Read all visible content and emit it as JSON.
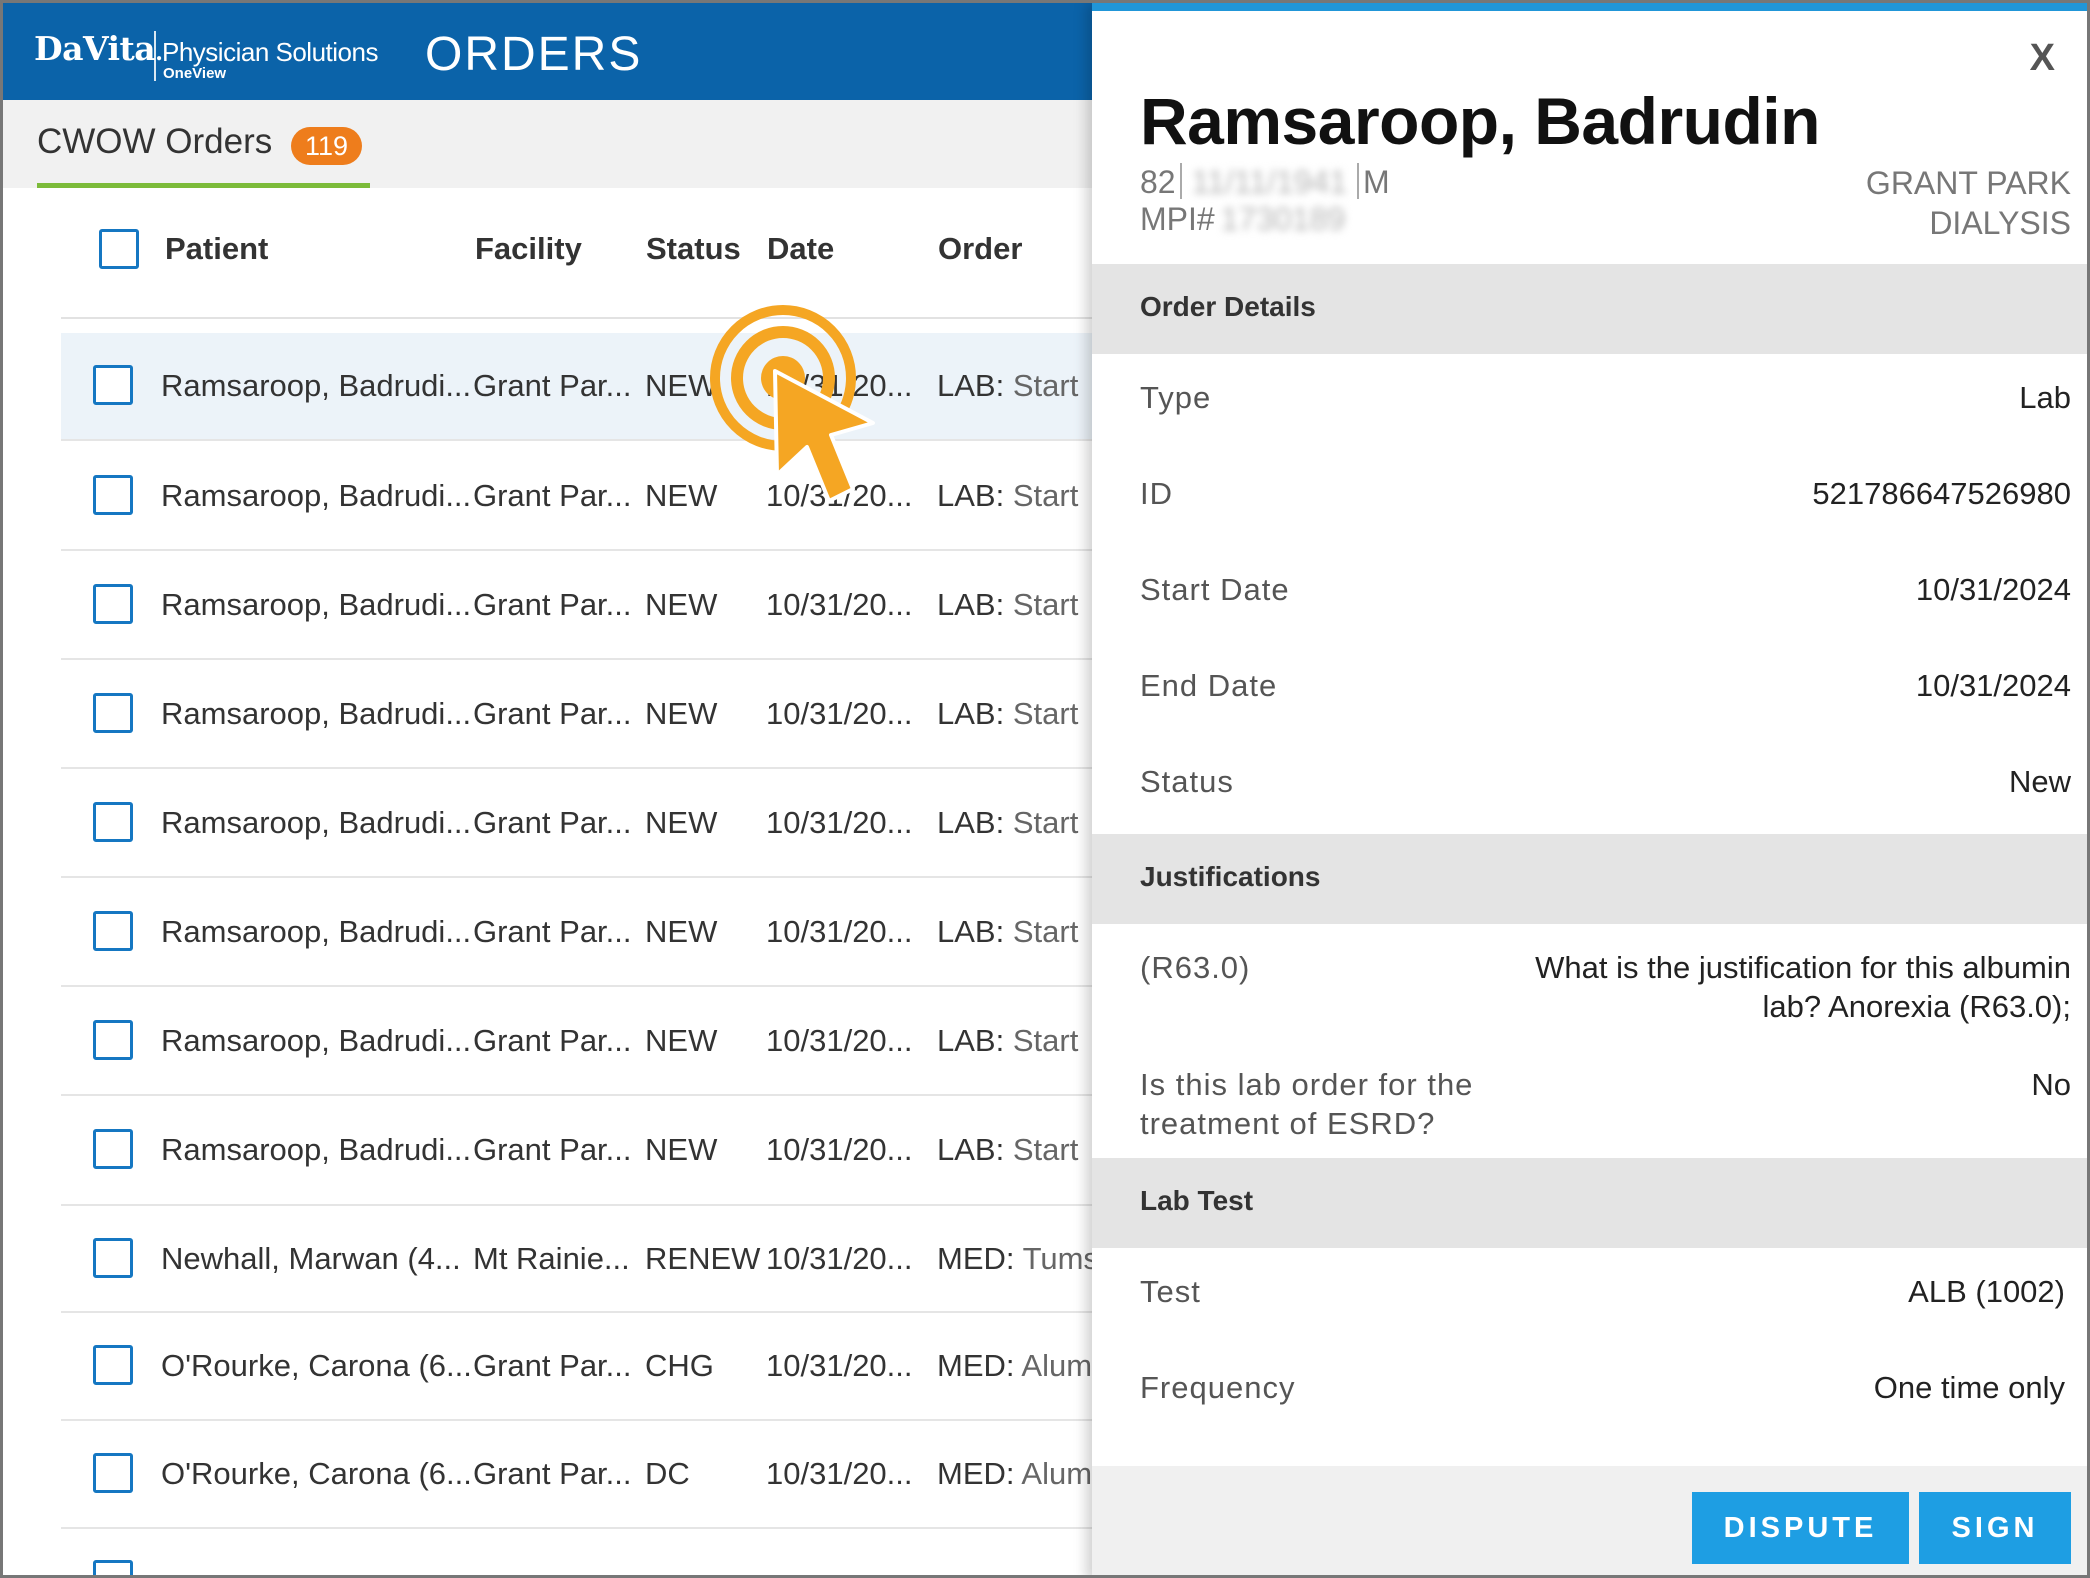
{
  "header": {
    "brand": "DaVita",
    "product": "Physician Solutions",
    "sub_product": "OneView",
    "title": "ORDERS"
  },
  "tab": {
    "label": "CWOW Orders",
    "count": "119"
  },
  "table": {
    "columns": [
      "Patient",
      "Facility",
      "Status",
      "Date",
      "Order"
    ],
    "rows": [
      {
        "patient": "Ramsaroop, Badrudi...",
        "facility": "Grant Par...",
        "status": "NEW",
        "date": "10/31/20...",
        "order_type": "LAB:",
        "order_desc": "Start"
      },
      {
        "patient": "Ramsaroop, Badrudi...",
        "facility": "Grant Par...",
        "status": "NEW",
        "date": "10/31/20...",
        "order_type": "LAB:",
        "order_desc": "Start"
      },
      {
        "patient": "Ramsaroop, Badrudi...",
        "facility": "Grant Par...",
        "status": "NEW",
        "date": "10/31/20...",
        "order_type": "LAB:",
        "order_desc": "Start"
      },
      {
        "patient": "Ramsaroop, Badrudi...",
        "facility": "Grant Par...",
        "status": "NEW",
        "date": "10/31/20...",
        "order_type": "LAB:",
        "order_desc": "Start"
      },
      {
        "patient": "Ramsaroop, Badrudi...",
        "facility": "Grant Par...",
        "status": "NEW",
        "date": "10/31/20...",
        "order_type": "LAB:",
        "order_desc": "Start"
      },
      {
        "patient": "Ramsaroop, Badrudi...",
        "facility": "Grant Par...",
        "status": "NEW",
        "date": "10/31/20...",
        "order_type": "LAB:",
        "order_desc": "Start"
      },
      {
        "patient": "Ramsaroop, Badrudi...",
        "facility": "Grant Par...",
        "status": "NEW",
        "date": "10/31/20...",
        "order_type": "LAB:",
        "order_desc": "Start"
      },
      {
        "patient": "Ramsaroop, Badrudi...",
        "facility": "Grant Par...",
        "status": "NEW",
        "date": "10/31/20...",
        "order_type": "LAB:",
        "order_desc": "Start"
      },
      {
        "patient": "Newhall, Marwan (4...",
        "facility": "Mt Rainie...",
        "status": "RENEW",
        "date": "10/31/20...",
        "order_type": "MED:",
        "order_desc": "Tums"
      },
      {
        "patient": "O'Rourke, Carona (6...",
        "facility": "Grant Par...",
        "status": "CHG",
        "date": "10/31/20...",
        "order_type": "MED:",
        "order_desc": "Alum"
      },
      {
        "patient": "O'Rourke, Carona (6...",
        "facility": "Grant Par...",
        "status": "DC",
        "date": "10/31/20...",
        "order_type": "MED:",
        "order_desc": "Alum"
      }
    ]
  },
  "panel": {
    "close_label": "X",
    "patient_name": "Ramsaroop, Badrudin",
    "age": "82",
    "dob": "11/11/1941",
    "sex": "M",
    "mpi_label": "MPI#",
    "mpi": "1730189",
    "facility_line1": "GRANT PARK",
    "facility_line2": "DIALYSIS",
    "sections": {
      "order_details": "Order Details",
      "justifications": "Justifications",
      "lab_test": "Lab Test"
    },
    "order_details": {
      "type_label": "Type",
      "type_value": "Lab",
      "id_label": "ID",
      "id_value": "521786647526980",
      "start_label": "Start Date",
      "start_value": "10/31/2024",
      "end_label": "End Date",
      "end_value": "10/31/2024",
      "status_label": "Status",
      "status_value": "New"
    },
    "justifications": {
      "j1_label": "(R63.0)",
      "j1_value_line1": "What is the justification for this albumin",
      "j1_value_line2": "lab? Anorexia (R63.0);",
      "j2_label_line1": "Is this lab order for the",
      "j2_label_line2": "treatment of ESRD?",
      "j2_value": "No"
    },
    "lab_test": {
      "test_label": "Test",
      "test_value": "ALB (1002)",
      "freq_label": "Frequency",
      "freq_value": "One time only"
    },
    "buttons": {
      "dispute": "DISPUTE",
      "sign": "SIGN"
    }
  },
  "colors": {
    "header_blue": "#0b63a9",
    "badge_orange": "#ee7d1c",
    "tab_underline_green": "#7cbb3a",
    "button_blue": "#1e9ee3",
    "click_indicator": "#f5a623"
  },
  "icons": {
    "click_indicator": "hand-pointer-click-icon"
  }
}
